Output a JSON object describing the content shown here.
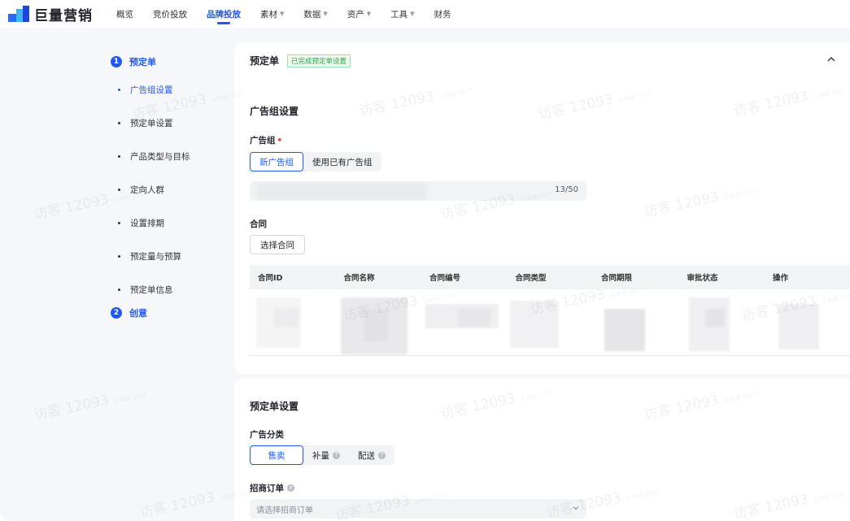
{
  "app": {
    "logo_text": "巨量营销",
    "nav": [
      {
        "label": "概览",
        "has_caret": false
      },
      {
        "label": "竞价投放",
        "has_caret": false
      },
      {
        "label": "品牌投放",
        "has_caret": false,
        "active": true
      },
      {
        "label": "素材",
        "has_caret": true
      },
      {
        "label": "数据",
        "has_caret": true
      },
      {
        "label": "资产",
        "has_caret": true
      },
      {
        "label": "工具",
        "has_caret": true
      },
      {
        "label": "财务",
        "has_caret": false
      }
    ],
    "accent_color": "#2158f5"
  },
  "steps": [
    {
      "num": "1",
      "title": "预定单",
      "items": [
        "广告组设置",
        "预定单设置",
        "产品类型与目标",
        "定向人群",
        "设置排期",
        "预定量与预算",
        "预定单信息"
      ],
      "active_index": 0
    },
    {
      "num": "2",
      "title": "创意",
      "items": []
    }
  ],
  "card1": {
    "title": "预定单",
    "status_tag": "已完成预定单设置",
    "section_title": "广告组设置",
    "ad_group_label": "广告组",
    "ad_group_options": [
      "新广告组",
      "使用已有广告组"
    ],
    "ad_group_selected": "新广告组",
    "name_counter": "13/50",
    "contract_label": "合同",
    "select_contract_button": "选择合同",
    "table_headers": [
      "合同ID",
      "合同名称",
      "合同编号",
      "合同类型",
      "合同期限",
      "审批状态",
      "操作"
    ]
  },
  "card2": {
    "section_title": "预定单设置",
    "category_label": "广告分类",
    "category_options": [
      {
        "label": "售卖",
        "help": false
      },
      {
        "label": "补量",
        "help": true
      },
      {
        "label": "配送",
        "help": true
      }
    ],
    "category_selected": "售卖",
    "merchant_order_label": "招商订单",
    "merchant_order_placeholder": "请选择招商订单"
  },
  "watermark": {
    "text": "访客 12093",
    "sub": "王晓丽 1517"
  }
}
